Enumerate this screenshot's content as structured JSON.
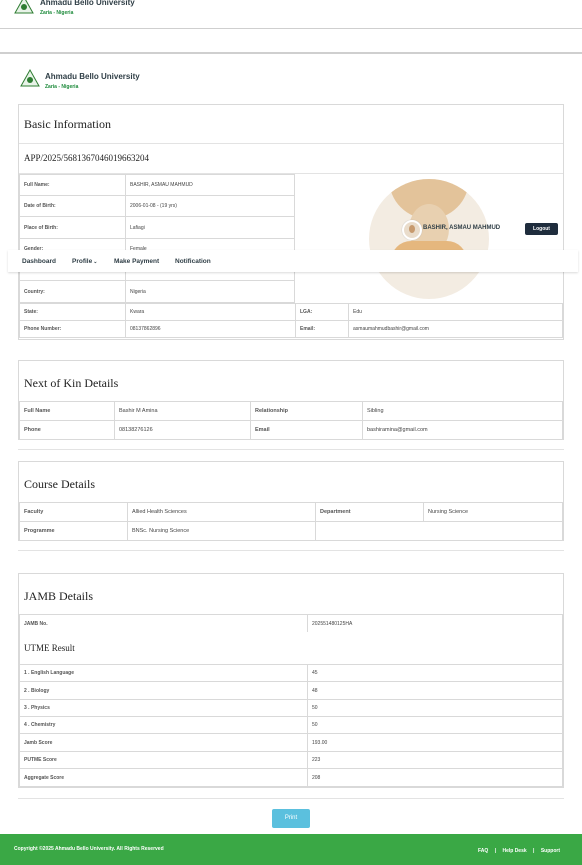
{
  "header": {
    "university": "Ahmadu Bello University",
    "location": "Zaria - Nigeria"
  },
  "nav": {
    "items": [
      "Dashboard",
      "Profile",
      "Make Payment",
      "Notification"
    ],
    "user_name": "BASHIR, ASMAU MAHMUD",
    "logout_label": "Logout"
  },
  "basic": {
    "title": "Basic Information",
    "app_no": "APP/2025/5681367046019663204",
    "rows": [
      {
        "label": "Full Name:",
        "value": "BASHIR, ASMAU MAHMUD"
      },
      {
        "label": "Date of Birth:",
        "value": "2006-01-08 - (19 yrs)"
      },
      {
        "label": "Place of Birth:",
        "value": "Lafiagi"
      },
      {
        "label": "Gender:",
        "value": "Female"
      },
      {
        "label": "Country:",
        "value": "Nigeria"
      }
    ],
    "state_label": "State:",
    "state_value": "Kwara",
    "lga_label": "LGA:",
    "lga_value": "Edu",
    "phone_label": "Phone Number:",
    "phone_value": "08137862896",
    "email_label": "Email:",
    "email_value": "asmaumahmudbashir@gmail.com"
  },
  "kin": {
    "title": "Next of Kin Details",
    "fullname_label": "Full Name",
    "fullname_value": "Bashir M Amina",
    "relationship_label": "Relationship",
    "relationship_value": "Sibling",
    "phone_label": "Phone",
    "phone_value": "08138276126",
    "email_label": "Email",
    "email_value": "bashiramina@gmail.com"
  },
  "course": {
    "title": "Course Details",
    "faculty_label": "Faculty",
    "faculty_value": "Allied Health Sciences",
    "department_label": "Department",
    "department_value": "Nursing Science",
    "programme_label": "Programme",
    "programme_value": "BNSc. Nursing Science"
  },
  "jamb": {
    "title": "JAMB Details",
    "jamb_no_label": "JAMB No.",
    "jamb_no_value": "202551480125HA",
    "utme_title": "UTME Result",
    "results": [
      {
        "label": "1 . English Language",
        "value": "45"
      },
      {
        "label": "2 . Biology",
        "value": "48"
      },
      {
        "label": "3 . Physics",
        "value": "50"
      },
      {
        "label": "4 . Chemistry",
        "value": "50"
      },
      {
        "label": "Jamb Score",
        "value": "193.00"
      },
      {
        "label": "PUTME Score",
        "value": "223"
      },
      {
        "label": "Aggregate Score",
        "value": "208"
      }
    ]
  },
  "print_label": "Print",
  "footer": {
    "copyright": "Copyright ©2025 Ahmadu Bello University. All Rights Reserved",
    "links": [
      "FAQ",
      "Help Desk",
      "Support"
    ]
  },
  "colors": {
    "footer_green": "#3aa845",
    "print_blue": "#5bc0de",
    "logout_navy": "#1f2d3d",
    "brand_green": "#1c8a3a"
  }
}
